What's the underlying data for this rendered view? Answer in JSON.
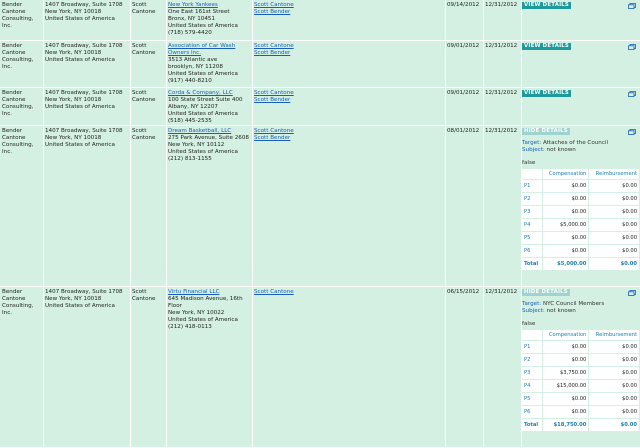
{
  "rows": [
    {
      "client": "Bender Cantone Consulting, Inc.",
      "client_address": [
        "1407 Broadway, Suite 1708",
        "New York, NY 10018",
        "United States of America"
      ],
      "signer": "Scott Cantone",
      "org_name": "New York Yankees",
      "org_address": [
        "One East 161st Street",
        "Bronx, NY 10451",
        "United States of America",
        "(718) 579-4420"
      ],
      "lobbyists": [
        "Scott Cantone",
        "Scott Bender"
      ],
      "start": "09/14/2012",
      "end": "12/31/2012",
      "button": "VIEW DETAILS"
    },
    {
      "client": "Bender Cantone Consulting, Inc.",
      "client_address": [
        "1407 Broadway, Suite 1708",
        "New York, NY 10018",
        "United States of America"
      ],
      "signer": "Scott Cantone",
      "org_name": "Association of Car Wash Owners Inc.",
      "org_address": [
        "3513 Atlantic ave",
        "brooklyn, NY 11208",
        "United States of America",
        "(917) 440-8210"
      ],
      "lobbyists": [
        "Scott Cantone",
        "Scott Bender"
      ],
      "start": "09/01/2012",
      "end": "12/31/2012",
      "button": "VIEW DETAILS"
    },
    {
      "client": "Bender Cantone Consulting, Inc.",
      "client_address": [
        "1407 Broadway, Suite 1708",
        "New York, NY 10018",
        "United States of America"
      ],
      "signer": "Scott Cantone",
      "org_name": "Corda & Company, LLC",
      "org_address": [
        "100 State Street Suite 400",
        "Albany, NY 12207",
        "United States of America",
        "(518) 445-2535"
      ],
      "lobbyists": [
        "Scott Cantone",
        "Scott Bender"
      ],
      "start": "09/01/2012",
      "end": "12/31/2012",
      "button": "VIEW DETAILS"
    },
    {
      "client": "Bender Cantone Consulting, Inc.",
      "client_address": [
        "1407 Broadway, Suite 1708",
        "New York, NY 10018",
        "United States of America"
      ],
      "signer": "Scott Cantone",
      "org_name": "Dream Basketball, LLC",
      "org_address": [
        "275 Park Avenue, Suite 2608",
        "New York, NY 10112",
        "United States of America",
        "(212) 813-1155"
      ],
      "lobbyists": [
        "Scott Cantone",
        "Scott Bender"
      ],
      "start": "08/01/2012",
      "end": "12/31/2012",
      "button": "HIDE DETAILS",
      "details": {
        "target_label": "Target:",
        "target": "Attaches of the Council",
        "subject_label": "Subject:",
        "subject": "not known",
        "flag": "false",
        "col_comp": "Compensation",
        "col_reimb": "Reimbursement",
        "periods": [
          {
            "q": "P1",
            "comp": "$0.00",
            "reimb": "$0.00"
          },
          {
            "q": "P2",
            "comp": "$0.00",
            "reimb": "$0.00"
          },
          {
            "q": "P3",
            "comp": "$0.00",
            "reimb": "$0.00"
          },
          {
            "q": "P4",
            "comp": "$5,000.00",
            "reimb": "$0.00"
          },
          {
            "q": "P5",
            "comp": "$0.00",
            "reimb": "$0.00"
          },
          {
            "q": "P6",
            "comp": "$0.00",
            "reimb": "$0.00"
          }
        ],
        "total_label": "Total",
        "total_comp": "$5,000.00",
        "total_reimb": "$0.00"
      }
    },
    {
      "client": "Bender Cantone Consulting, Inc.",
      "client_address": [
        "1407 Broadway, Suite 1708",
        "New York, NY 10018",
        "United States of America"
      ],
      "signer": "Scott Cantone",
      "org_name": "Virtu Financial LLC",
      "org_address": [
        "645 Madison Avenue, 16th Floor",
        "New York, NY 10022",
        "United States of America",
        "(212) 418-0113"
      ],
      "lobbyists": [
        "Scott Cantone"
      ],
      "start": "06/15/2012",
      "end": "12/31/2012",
      "button": "HIDE DETAILS",
      "details": {
        "target_label": "Target:",
        "target": "NYC Council Members",
        "subject_label": "Subject:",
        "subject": "not known",
        "flag": "false",
        "col_comp": "Compensation",
        "col_reimb": "Reimbursement",
        "periods": [
          {
            "q": "P1",
            "comp": "$0.00",
            "reimb": "$0.00"
          },
          {
            "q": "P2",
            "comp": "$0.00",
            "reimb": "$0.00"
          },
          {
            "q": "P3",
            "comp": "$3,750.00",
            "reimb": "$0.00"
          },
          {
            "q": "P4",
            "comp": "$15,000.00",
            "reimb": "$0.00"
          },
          {
            "q": "P5",
            "comp": "$0.00",
            "reimb": "$0.00"
          },
          {
            "q": "P6",
            "comp": "$0.00",
            "reimb": "$0.00"
          }
        ],
        "total_label": "Total",
        "total_comp": "$18,750.00",
        "total_reimb": "$0.00"
      }
    }
  ]
}
